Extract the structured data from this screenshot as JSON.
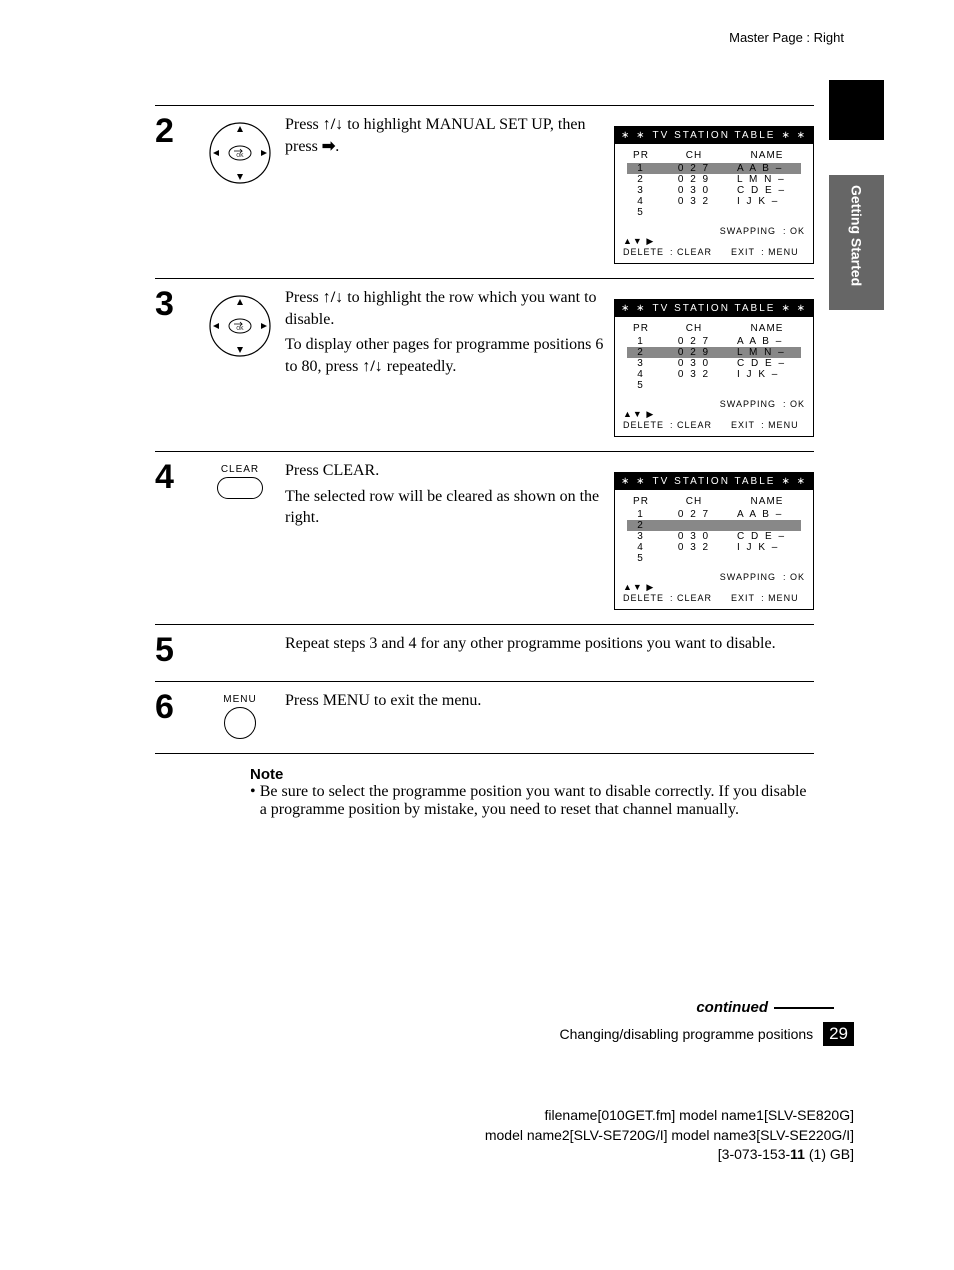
{
  "header": {
    "master_page": "Master Page : Right"
  },
  "side_tab": "Getting Started",
  "steps": {
    "s2": {
      "num": "2",
      "text_a": "Press ",
      "text_b": " to highlight MANUAL SET UP, then press ",
      "text_c": "."
    },
    "s3": {
      "num": "3",
      "p1_a": "Press ",
      "p1_b": " to highlight the row which you want to disable.",
      "p2_a": "To display other pages for programme positions 6 to 80, press ",
      "p2_b": " repeatedly."
    },
    "s4": {
      "num": "4",
      "btn": "CLEAR",
      "p1": "Press CLEAR.",
      "p2": "The selected row will be cleared as shown on the right."
    },
    "s5": {
      "num": "5",
      "p1": "Repeat steps 3 and 4 for any other programme positions you want to disable."
    },
    "s6": {
      "num": "6",
      "btn": "MENU",
      "p1": "Press MENU to exit the menu."
    }
  },
  "osd": {
    "title": "TV STATION TABLE",
    "ast": "∗ ∗",
    "cols": {
      "c1": "PR",
      "c2": "CH",
      "c3": "NAME"
    },
    "table1": [
      {
        "pr": "1",
        "ch": "0 2 7",
        "name": "A A B –",
        "hl": true
      },
      {
        "pr": "2",
        "ch": "0 2 9",
        "name": "L M N –",
        "hl": false
      },
      {
        "pr": "3",
        "ch": "0 3 0",
        "name": "C D E –",
        "hl": false
      },
      {
        "pr": "4",
        "ch": "0 3 2",
        "name": "I J K –",
        "hl": false
      },
      {
        "pr": "5",
        "ch": "",
        "name": "",
        "hl": false
      }
    ],
    "table2": [
      {
        "pr": "1",
        "ch": "0 2 7",
        "name": "A A B –",
        "hl": false
      },
      {
        "pr": "2",
        "ch": "0 2 9",
        "name": "L M N –",
        "hl": true
      },
      {
        "pr": "3",
        "ch": "0 3 0",
        "name": "C D E –",
        "hl": false
      },
      {
        "pr": "4",
        "ch": "0 3 2",
        "name": "I J K –",
        "hl": false
      },
      {
        "pr": "5",
        "ch": "",
        "name": "",
        "hl": false
      }
    ],
    "table3": [
      {
        "pr": "1",
        "ch": "0 2 7",
        "name": "A A B –",
        "hl": false
      },
      {
        "pr": "2",
        "ch": "",
        "name": "",
        "hl": true
      },
      {
        "pr": "3",
        "ch": "0 3 0",
        "name": "C D E –",
        "hl": false
      },
      {
        "pr": "4",
        "ch": "0 3 2",
        "name": "I J K –",
        "hl": false
      },
      {
        "pr": "5",
        "ch": "",
        "name": "",
        "hl": false
      }
    ],
    "foot": {
      "swap": "SWAPPING",
      "ok": ": OK",
      "nav_sym": "▲▼ ▶",
      "delete": "DELETE",
      "clear": ": CLEAR",
      "exit": "EXIT",
      "menu": ": MENU"
    }
  },
  "note": {
    "head": "Note",
    "item1": "Be sure to select the programme position you want to disable correctly.  If you disable a programme position by mistake, you need to reset that channel manually."
  },
  "footer": {
    "continued": "continued",
    "section": "Changing/disabling programme positions",
    "page": "29",
    "file1": "filename[010GET.fm] model name1[SLV-SE820G]",
    "file2": "model name2[SLV-SE720G/I] model name3[SLV-SE220G/I]",
    "file3a": "[3-073-153-",
    "file3b": "11",
    "file3c": " (1) GB]"
  }
}
